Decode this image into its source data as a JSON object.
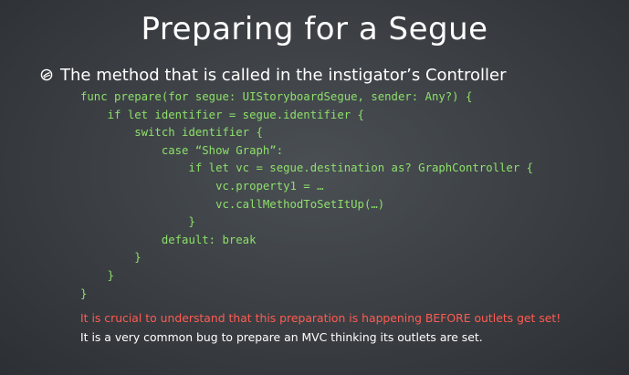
{
  "slide": {
    "title": "Preparing for a Segue",
    "bullet_icon": "bullet-swirl-icon",
    "bullet_text": "The method that is called in the instigator’s Controller",
    "code_color": "#8ee06a",
    "code_lines": [
      "func prepare(for segue: UIStoryboardSegue, sender: Any?) {",
      "    if let identifier = segue.identifier {",
      "        switch identifier {",
      "            case “Show Graph”:",
      "                if let vc = segue.destination as? GraphController {",
      "                    vc.property1 = …",
      "                    vc.callMethodToSetItUp(…)",
      "                }",
      "            default: break",
      "        }",
      "    }",
      "}"
    ],
    "warning_text": "It is crucial to understand that this preparation is happening BEFORE outlets get set!",
    "warning_color": "#ff5b52",
    "bug_text": "It is a very common bug to prepare an MVC thinking its outlets are set."
  }
}
